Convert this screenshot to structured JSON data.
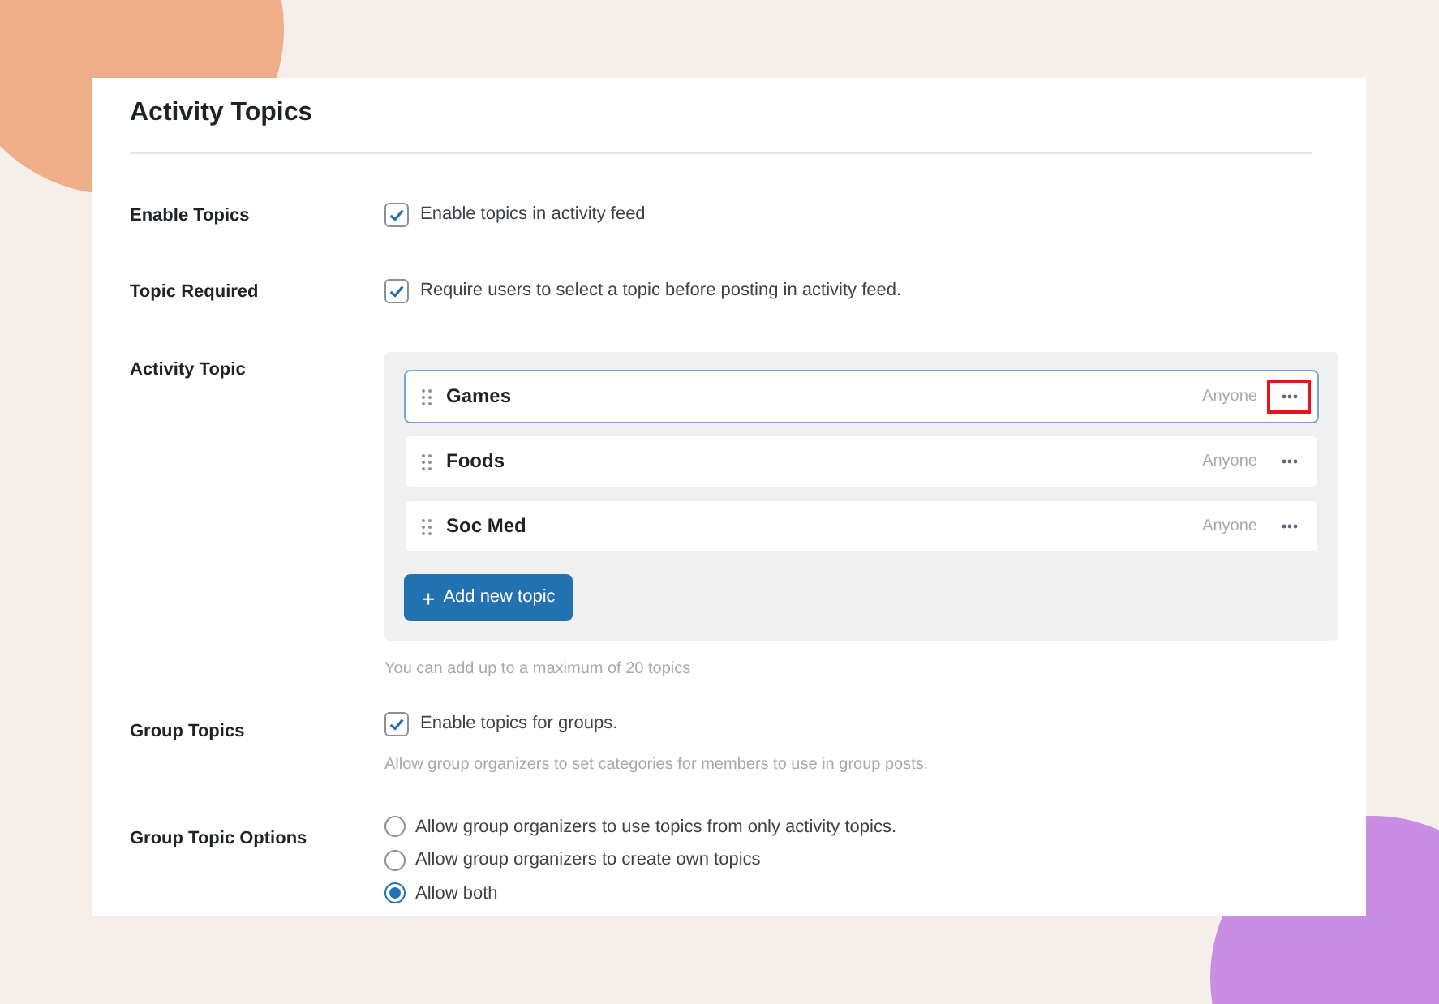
{
  "title": "Activity Topics",
  "enable_topics": {
    "label": "Enable Topics",
    "option": "Enable topics in activity feed",
    "checked": true
  },
  "topic_required": {
    "label": "Topic Required",
    "option": "Require users to select a topic before posting in activity feed.",
    "checked": true
  },
  "activity_topic": {
    "label": "Activity Topic",
    "topics": [
      {
        "name": "Games",
        "audience": "Anyone",
        "selected": true,
        "menu_highlighted": true
      },
      {
        "name": "Foods",
        "audience": "Anyone",
        "selected": false,
        "menu_highlighted": false
      },
      {
        "name": "Soc Med",
        "audience": "Anyone",
        "selected": false,
        "menu_highlighted": false
      }
    ],
    "add_button": "Add new topic",
    "add_icon": "+",
    "hint": "You can add up to a maximum of 20 topics"
  },
  "group_topics": {
    "label": "Group Topics",
    "option": "Enable topics for groups.",
    "checked": true,
    "hint": "Allow group organizers to set categories for members to use in group posts."
  },
  "group_topic_options": {
    "label": "Group Topic Options",
    "options": [
      {
        "label": "Allow group organizers to use topics from only activity topics.",
        "selected": false
      },
      {
        "label": "Allow group organizers to create own topics",
        "selected": false
      },
      {
        "label": "Allow both",
        "selected": true
      }
    ]
  }
}
